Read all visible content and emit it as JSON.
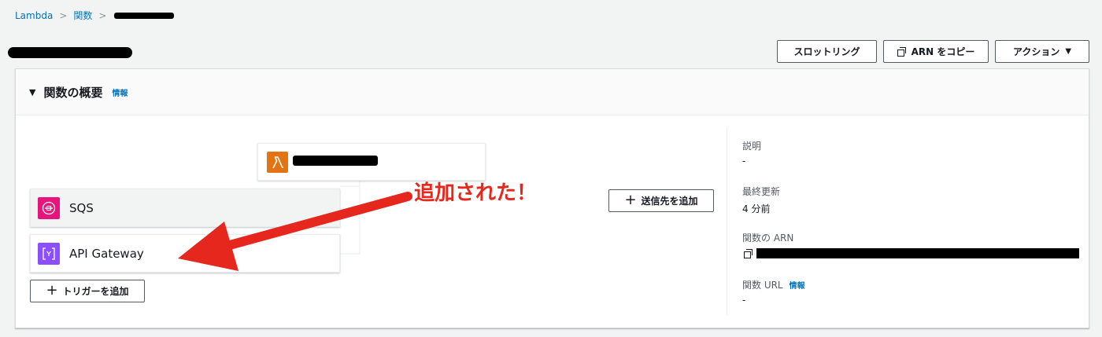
{
  "breadcrumb": {
    "home": "Lambda",
    "functions": "関数"
  },
  "header": {
    "throttle_label": "スロットリング",
    "copy_arn_label": "ARN をコピー",
    "actions_label": "アクション"
  },
  "overview": {
    "title": "関数の概要",
    "info": "情報",
    "triggers": [
      {
        "label": "SQS",
        "icon": "sqs-icon",
        "color": "#e7157b"
      },
      {
        "label": "API Gateway",
        "icon": "api-gateway-icon",
        "color": "#8c4fff"
      }
    ],
    "add_trigger_label": "トリガーを追加",
    "add_destination_label": "送信先を追加"
  },
  "details": {
    "description_label": "説明",
    "description_value": "-",
    "last_modified_label": "最終更新",
    "last_modified_value": "4 分前",
    "arn_label": "関数の ARN",
    "url_label": "関数 URL",
    "url_info": "情報",
    "url_value": "-"
  },
  "annotation": {
    "text": "追加された！",
    "color": "#e5271e"
  },
  "colors": {
    "link": "#0073bb",
    "lambda": "#e27414"
  }
}
